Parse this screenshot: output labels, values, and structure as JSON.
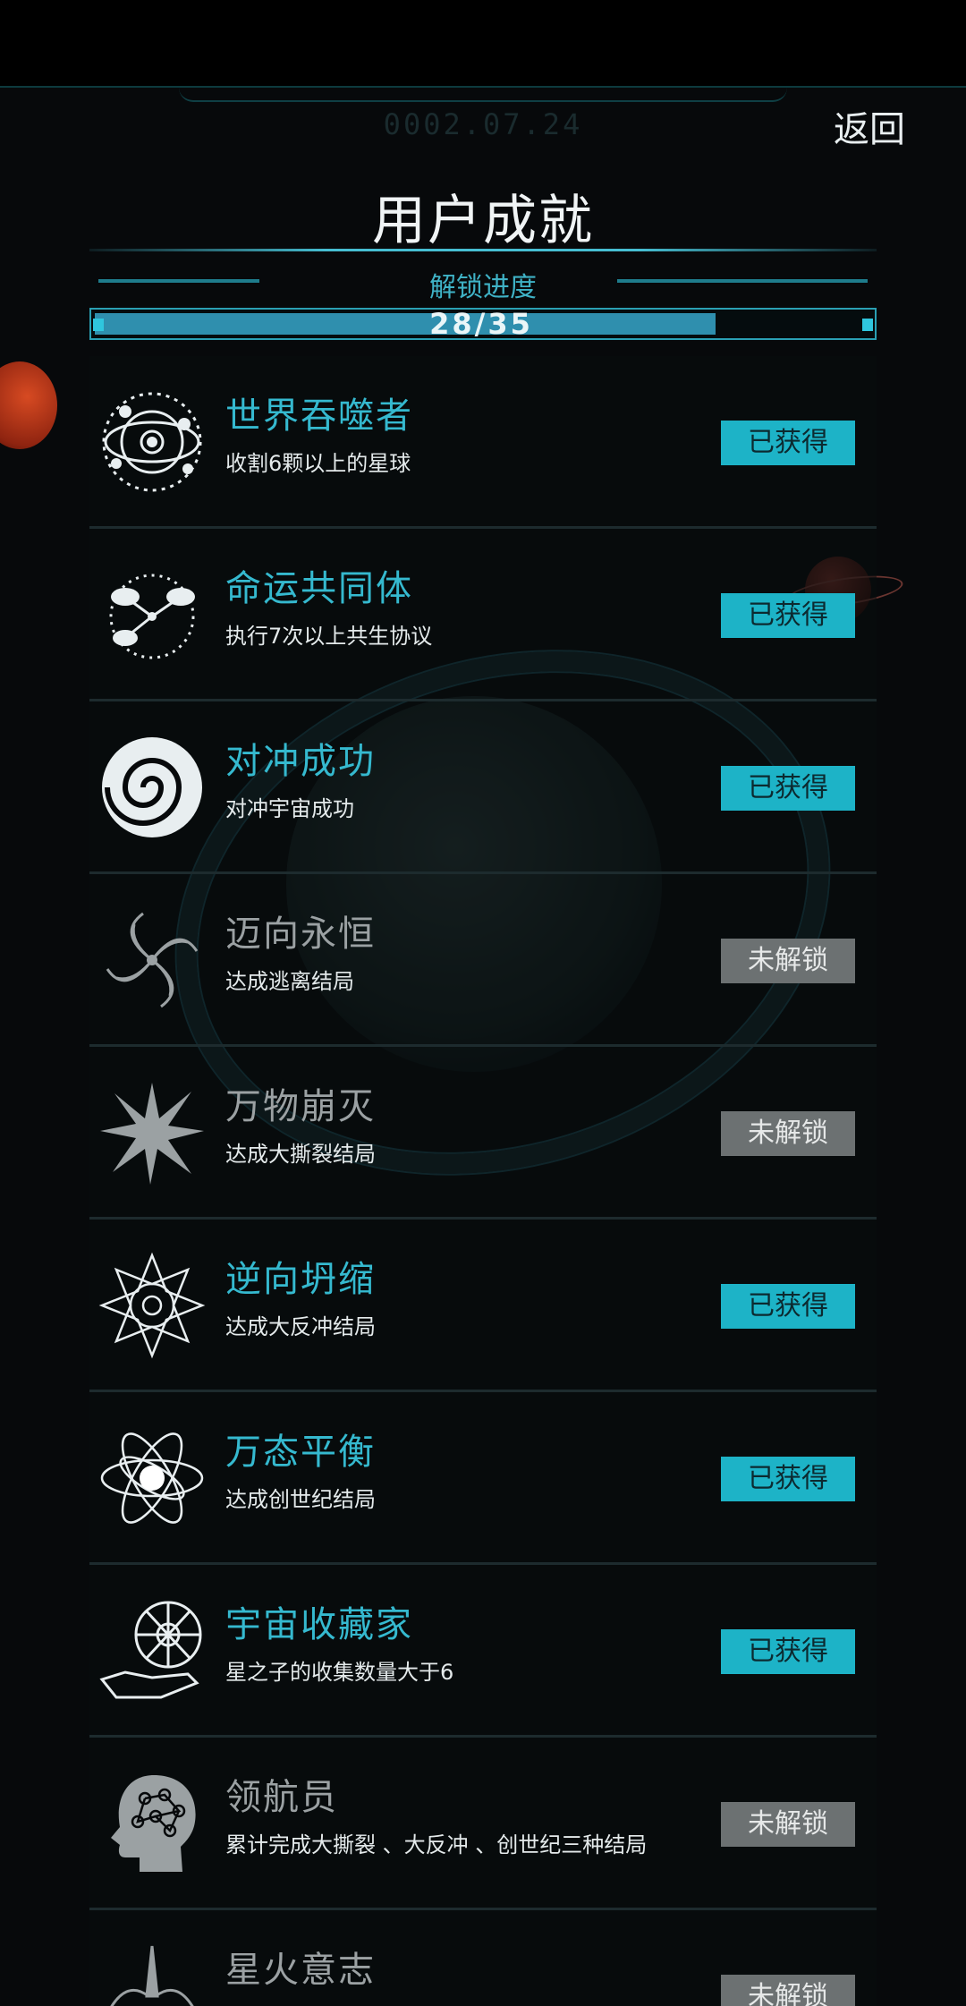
{
  "header": {
    "date": "0002.07.24",
    "back_label": "返回",
    "title": "用户成就"
  },
  "progress": {
    "label": "解锁进度",
    "text": "28/35",
    "unlocked": 28,
    "total": 35,
    "fill_color": "#2f8fae"
  },
  "colors": {
    "accent": "#35b9cf",
    "badge_earned": "#1db3c7",
    "badge_locked": "#6c7172"
  },
  "achievements": [
    {
      "icon": "orbit-system-icon",
      "name": "世界吞噬者",
      "desc": "收割6颗以上的星球",
      "status": "已获得",
      "earned": true
    },
    {
      "icon": "linked-planets-icon",
      "name": "命运共同体",
      "desc": "执行7次以上共生协议",
      "status": "已获得",
      "earned": true
    },
    {
      "icon": "swirl-icon",
      "name": "对冲成功",
      "desc": "对冲宇宙成功",
      "status": "已获得",
      "earned": true
    },
    {
      "icon": "spiral-galaxy-icon",
      "name": "迈向永恒",
      "desc": "达成逃离结局",
      "status": "未解锁",
      "earned": false
    },
    {
      "icon": "starburst-icon",
      "name": "万物崩灭",
      "desc": "达成大撕裂结局",
      "status": "未解锁",
      "earned": false
    },
    {
      "icon": "mandala-icon",
      "name": "逆向坍缩",
      "desc": "达成大反冲结局",
      "status": "已获得",
      "earned": true
    },
    {
      "icon": "atom-orbits-icon",
      "name": "万态平衡",
      "desc": "达成创世纪结局",
      "status": "已获得",
      "earned": true
    },
    {
      "icon": "collector-sphere-icon",
      "name": "宇宙收藏家",
      "desc": "星之子的收集数量大于6",
      "status": "已获得",
      "earned": true
    },
    {
      "icon": "brain-head-icon",
      "name": "领航员",
      "desc": "累计完成大撕裂 、大反冲 、创世纪三种结局",
      "status": "未解锁",
      "earned": false
    },
    {
      "icon": "rising-fire-icon",
      "name": "星火意志",
      "desc": "",
      "status": "未解锁",
      "earned": false
    }
  ]
}
